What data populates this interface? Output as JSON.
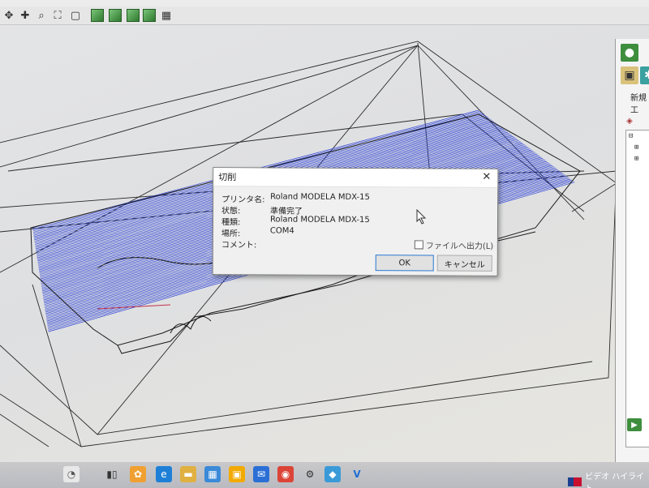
{
  "toolbar": {
    "buttons": [
      "move-icon",
      "pan-icon",
      "zoom-icon",
      "fit-icon",
      "box-icon",
      "cube-icon",
      "cube-icon",
      "cube-icon",
      "cube-icon",
      "grid-icon"
    ]
  },
  "right_panel": {
    "label": "新規工"
  },
  "dialog": {
    "title": "切削",
    "rows": [
      {
        "label": "プリンタ名:",
        "value": "Roland MODELA MDX-15"
      },
      {
        "label": "状態:",
        "value": "準備完了"
      },
      {
        "label": "種類:",
        "value": "Roland MODELA MDX-15"
      },
      {
        "label": "場所:",
        "value": "COM4"
      },
      {
        "label": "コメント:",
        "value": ""
      }
    ],
    "print_to_file_label": "ファイルへ出力(L)",
    "print_to_file_checked": false,
    "ok_label": "OK",
    "cancel_label": "キャンセル"
  },
  "taskbar": {
    "news_text": "ビデオ ハイライト"
  },
  "colors": {
    "toolpath": "#2a3fd6",
    "wireframe": "#2a2a2a",
    "dialog_bg": "#f0f0f0"
  }
}
